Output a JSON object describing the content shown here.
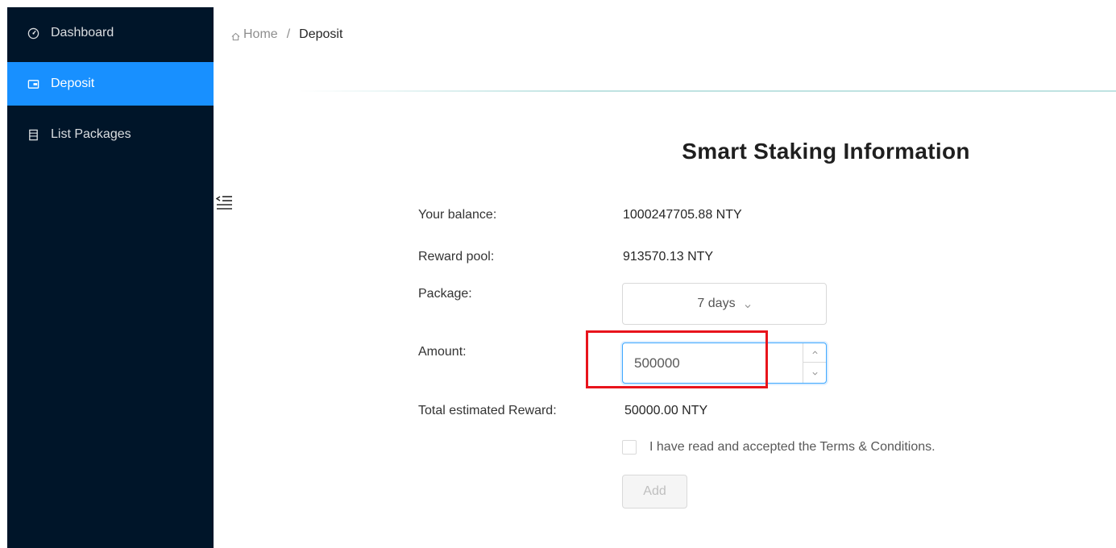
{
  "sidebar": {
    "items": [
      {
        "label": "Dashboard",
        "icon": "dashboard-icon"
      },
      {
        "label": "Deposit",
        "icon": "wallet-icon",
        "active": true
      },
      {
        "label": "List Packages",
        "icon": "book-icon"
      }
    ]
  },
  "breadcrumb": {
    "home": "Home",
    "separator": "/",
    "current": "Deposit"
  },
  "form": {
    "title": "Smart Staking Information",
    "balance_label": "Your balance:",
    "balance_value": "1000247705.88 NTY",
    "reward_pool_label": "Reward pool:",
    "reward_pool_value": "913570.13 NTY",
    "package_label": "Package:",
    "package_value": "7 days",
    "amount_label": "Amount:",
    "amount_value": "500000",
    "total_reward_label": "Total estimated Reward:",
    "total_reward_value": "50000.00 NTY",
    "terms_label": "I have read and accepted the Terms & Conditions.",
    "terms_checked": false,
    "add_button": "Add"
  },
  "colors": {
    "sidebar_bg": "#001529",
    "active": "#1890ff",
    "highlight_box": "#e8141c"
  }
}
